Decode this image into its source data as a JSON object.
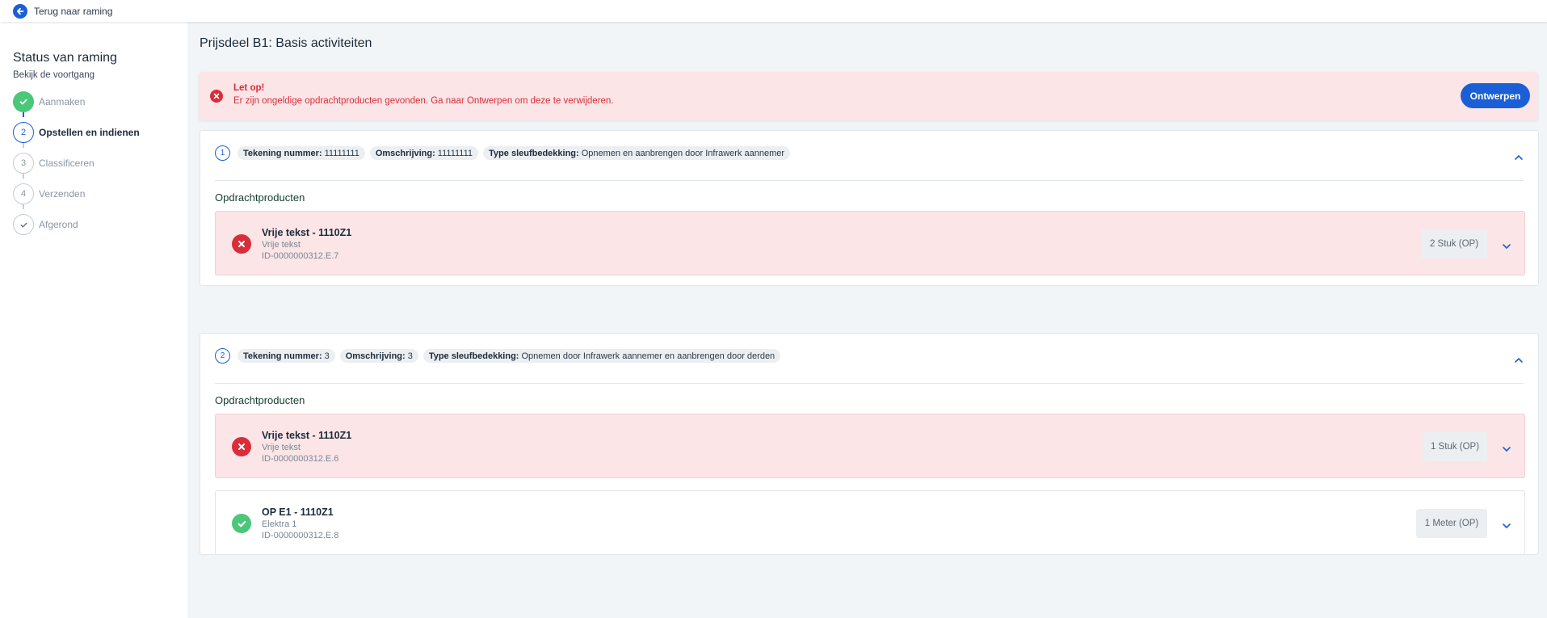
{
  "topbar": {
    "back_label": "Terug naar raming"
  },
  "sidebar": {
    "title": "Status van raming",
    "subtitle": "Bekijk de voortgang",
    "steps": [
      {
        "number": "",
        "label": "Aanmaken",
        "state": "done"
      },
      {
        "number": "2",
        "label": "Opstellen en indienen",
        "state": "active"
      },
      {
        "number": "3",
        "label": "Classificeren",
        "state": "pending"
      },
      {
        "number": "4",
        "label": "Verzenden",
        "state": "pending"
      },
      {
        "number": "",
        "label": "Afgerond",
        "state": "pending-check"
      }
    ]
  },
  "main": {
    "title": "Prijsdeel B1: Basis activiteiten",
    "alert": {
      "title": "Let op!",
      "text": "Er zijn ongeldige opdrachtproducten gevonden. Ga naar Ontwerpen om deze te verwijderen.",
      "button": "Ontwerpen"
    },
    "cards": [
      {
        "number": "1",
        "chips": [
          {
            "key": "Tekening nummer:",
            "value": "11111111"
          },
          {
            "key": "Omschrijving:",
            "value": "11111111"
          },
          {
            "key": "Type sleufbedekking:",
            "value": "Opnemen en aanbrengen door Infrawerk aannemer"
          }
        ],
        "section_title": "Opdrachtproducten",
        "products": [
          {
            "name": "Vrije tekst - 1110Z1",
            "type": "Vrije tekst",
            "id": "ID-0000000312.E.7",
            "quantity": "2 Stuk (OP)",
            "status": "error"
          }
        ]
      },
      {
        "number": "2",
        "chips": [
          {
            "key": "Tekening nummer:",
            "value": "3"
          },
          {
            "key": "Omschrijving:",
            "value": "3"
          },
          {
            "key": "Type sleufbedekking:",
            "value": "Opnemen door Infrawerk aannemer en aanbrengen door derden"
          }
        ],
        "section_title": "Opdrachtproducten",
        "products": [
          {
            "name": "Vrije tekst - 1110Z1",
            "type": "Vrije tekst",
            "id": "ID-0000000312.E.6",
            "quantity": "1 Stuk (OP)",
            "status": "error"
          },
          {
            "name": "OP E1 - 1110Z1",
            "type": "Elektra 1",
            "id": "ID-0000000312.E.8",
            "quantity": "1 Meter (OP)",
            "status": "ok"
          }
        ]
      }
    ]
  },
  "colors": {
    "accent": "#1a5fd6",
    "error": "#d92d3a",
    "error_bg": "#fbe5e7",
    "success": "#4bc77a"
  }
}
